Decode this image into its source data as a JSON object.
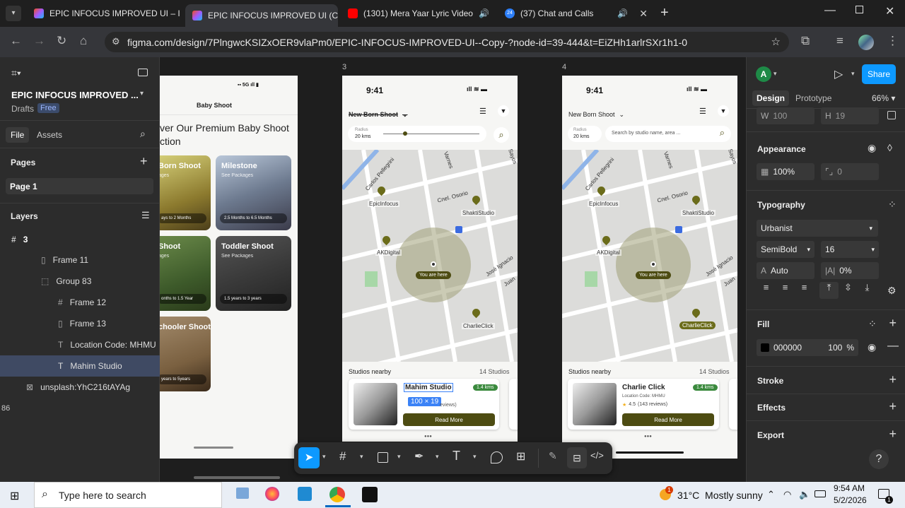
{
  "browser": {
    "tabs": [
      {
        "label": "EPIC INFOCUS IMPROVED UI – I",
        "color": "#a259ff"
      },
      {
        "label": "EPIC INFOCUS IMPROVED UI (C",
        "color": "#a259ff"
      },
      {
        "label": "(1301) Mera Yaar Lyric Video",
        "color": "#ff0000"
      },
      {
        "label": "(37) Chat and Calls",
        "color": "#2d7ff9"
      }
    ],
    "tab4_badge": "24",
    "url": "figma.com/design/7PlngwcKSIZxOER9vlaPm0/EPIC-INFOCUS-IMPROVED-UI--Copy-?node-id=39-444&t=EiZHh1arlrSXr1h1-0"
  },
  "left_panel": {
    "file_title": "EPIC INFOCUS IMPROVED ...",
    "drafts": "Drafts",
    "plan": "Free",
    "tab_file": "File",
    "tab_assets": "Assets",
    "pages_title": "Pages",
    "page1": "Page 1",
    "layers_title": "Layers",
    "layers": [
      {
        "label": "3",
        "indent": 0
      },
      {
        "label": "Frame 11",
        "indent": 1
      },
      {
        "label": "Group 83",
        "indent": 1
      },
      {
        "label": "Frame 12",
        "indent": 2
      },
      {
        "label": "Frame 13",
        "indent": 2
      },
      {
        "label": "Location Code: MHMU",
        "indent": 2
      },
      {
        "label": "Mahim Studio",
        "indent": 2
      },
      {
        "label": "unsplash:YhC216tAYAg",
        "indent": 1
      }
    ],
    "bottom_number": "86"
  },
  "canvas": {
    "frame3_label": "3",
    "frame4_label": "4",
    "left_phone": {
      "status": "5G",
      "header": "Baby Shoot",
      "heading_line1": "ver Our Premium Baby Shoot",
      "heading_line2": "ction",
      "cards": [
        {
          "title": "Born Shoot",
          "sub": "ages",
          "age": "ays to 2 Months"
        },
        {
          "title": "Milestone",
          "sub": "See Packages",
          "age": "2.5 Months to 6.5 Months"
        },
        {
          "title": "Shoot",
          "sub": "ages",
          "age": "onths to 1.5 Year"
        },
        {
          "title": "Toddler Shoot",
          "sub": "See Packages",
          "age": "1.5 years to 3 years"
        },
        {
          "title": "chooler Shoot",
          "sub": "",
          "age": "years to 5years"
        }
      ]
    },
    "phone3": {
      "time": "9:41",
      "dropdown": "New Born Shoot",
      "radius_label": "Radius",
      "radius_value": "20 kms",
      "markers": [
        "EpicInfocus",
        "ShaktiStudio",
        "AKDigital",
        "CharlieClick"
      ],
      "you_are_here": "You are here",
      "streets": [
        "Carlos Pellegrini",
        "Cnel. Osorio",
        "José Ignacio",
        "Juan",
        "Varnes",
        "Sayos"
      ],
      "studios_nearby": "Studios nearby",
      "studios_count": "14 Studios",
      "card_title": "Mahim Studio",
      "card_distance": "1.4 kms",
      "card_location": "Location Code: MHMU",
      "card_reviews": "eviews)",
      "selection_size": "100 × 19",
      "read_more": "Read More"
    },
    "phone4": {
      "time": "9:41",
      "dropdown": "New Born Shoot",
      "radius_label": "Radius",
      "radius_value": "20 kms",
      "search_placeholder": "Search by studio name, area ...",
      "markers": [
        "EpicInfocus",
        "ShaktiStudio",
        "AKDigital",
        "CharlieClick"
      ],
      "you_are_here": "You are here",
      "streets": [
        "Carlos Pellegrini",
        "Cnel. Osorio",
        "José Ignacio",
        "Juan",
        "Varnes",
        "Sayos"
      ],
      "studios_nearby": "Studios nearby",
      "studios_count": "14 Studios",
      "card_title": "Charlie Click",
      "card_distance": "1.4 kms",
      "card_location": "Location Code: MHMU",
      "card_rating": "4.5",
      "card_reviews": "(143 reviews)",
      "read_more": "Read More"
    }
  },
  "right_panel": {
    "avatar": "A",
    "share": "Share",
    "tab_design": "Design",
    "tab_prototype": "Prototype",
    "zoom": "66%",
    "w_label": "W",
    "w_value": "100",
    "h_label": "H",
    "h_value": "19",
    "appearance": "Appearance",
    "opacity": "100%",
    "radius": "0",
    "typography": "Typography",
    "font": "Urbanist",
    "weight": "SemiBold",
    "size": "16",
    "line_height": "Auto",
    "letter_spacing": "0%",
    "fill": "Fill",
    "fill_hex": "000000",
    "fill_opacity": "100",
    "fill_pct": "%",
    "stroke": "Stroke",
    "effects": "Effects",
    "export": "Export",
    "help": "?"
  },
  "taskbar": {
    "search_placeholder": "Type here to search",
    "weather": "31°C  Mostly sunny",
    "time": "9:54 AM",
    "date": "5/2/2026",
    "weather_badge": "1",
    "notif_badge": "1"
  }
}
